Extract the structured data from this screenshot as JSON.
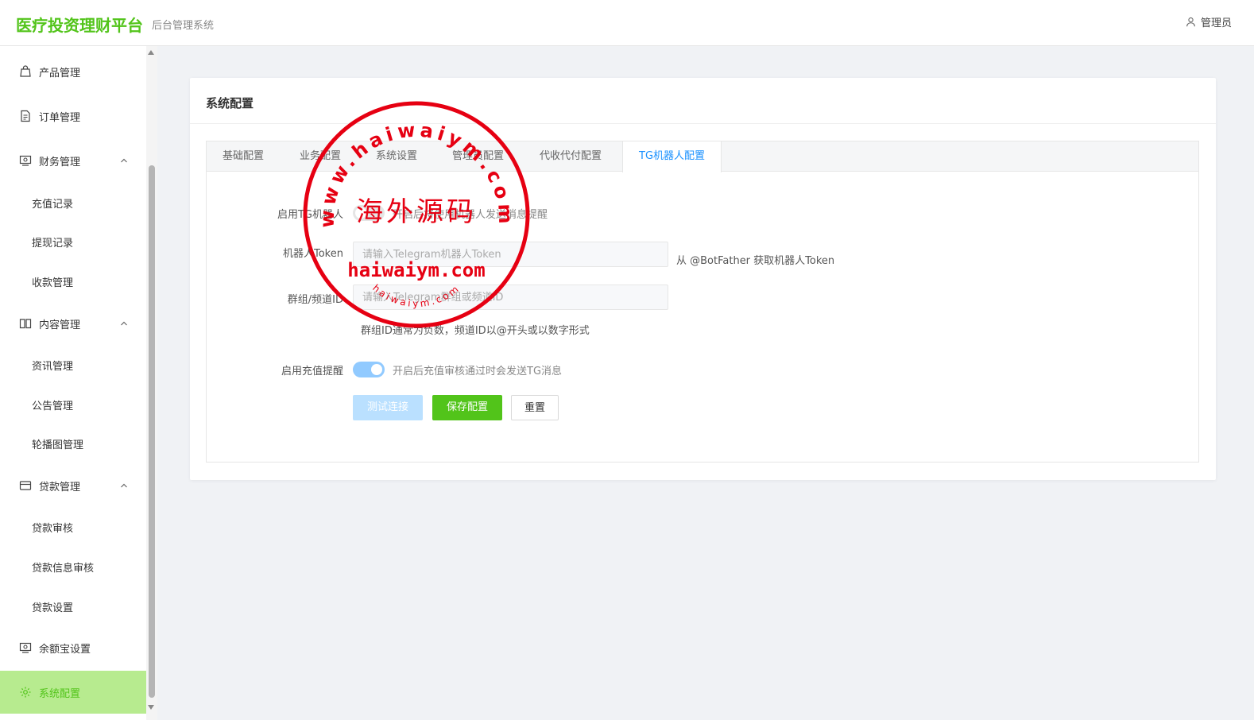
{
  "header": {
    "brand": "医疗投资理财平台",
    "subtitle": "后台管理系统",
    "user": "管理员"
  },
  "sidebar": {
    "items": [
      {
        "label": "产品管理",
        "icon": "bag-icon"
      },
      {
        "label": "订单管理",
        "icon": "document-icon"
      },
      {
        "label": "财务管理",
        "icon": "finance-icon",
        "children": [
          "充值记录",
          "提现记录",
          "收款管理"
        ]
      },
      {
        "label": "内容管理",
        "icon": "book-icon",
        "children": [
          "资讯管理",
          "公告管理",
          "轮播图管理"
        ]
      },
      {
        "label": "贷款管理",
        "icon": "card-icon",
        "children": [
          "贷款审核",
          "贷款信息审核",
          "贷款设置"
        ]
      },
      {
        "label": "余额宝设置",
        "icon": "finance-icon"
      },
      {
        "label": "系统配置",
        "icon": "gear-icon",
        "active": true
      }
    ]
  },
  "card": {
    "title": "系统配置",
    "tabs": [
      {
        "label": "基础配置"
      },
      {
        "label": "业务配置"
      },
      {
        "label": "系统设置"
      },
      {
        "label": "管理员配置"
      },
      {
        "label": "代收代付配置"
      },
      {
        "label": "TG机器人配置",
        "active": true
      }
    ]
  },
  "form": {
    "enable_bot": {
      "label": "启用TG机器人",
      "text": "开启后将使用机器人发送消息提醒",
      "on": false
    },
    "token": {
      "label": "机器人Token",
      "placeholder": "请输入Telegram机器人Token",
      "value": "",
      "hint": "从 @BotFather 获取机器人Token"
    },
    "chat_id": {
      "label": "群组/频道ID",
      "placeholder": "请输入Telegram群组或频道ID",
      "value": "",
      "hint": "群组ID通常为负数，频道ID以@开头或以数字形式"
    },
    "recharge_notice": {
      "label": "启用充值提醒",
      "text": "开启后充值审核通过时会发送TG消息",
      "on": true
    },
    "buttons": {
      "test": "测试连接",
      "save": "保存配置",
      "reset": "重置"
    }
  },
  "watermark": {
    "top_text": "www.haiwaiym.com",
    "center_text": "海外源码",
    "domain_text": "haiwaiym.com",
    "bottom_text": "haiwaiym.com",
    "color": "#e60012"
  }
}
